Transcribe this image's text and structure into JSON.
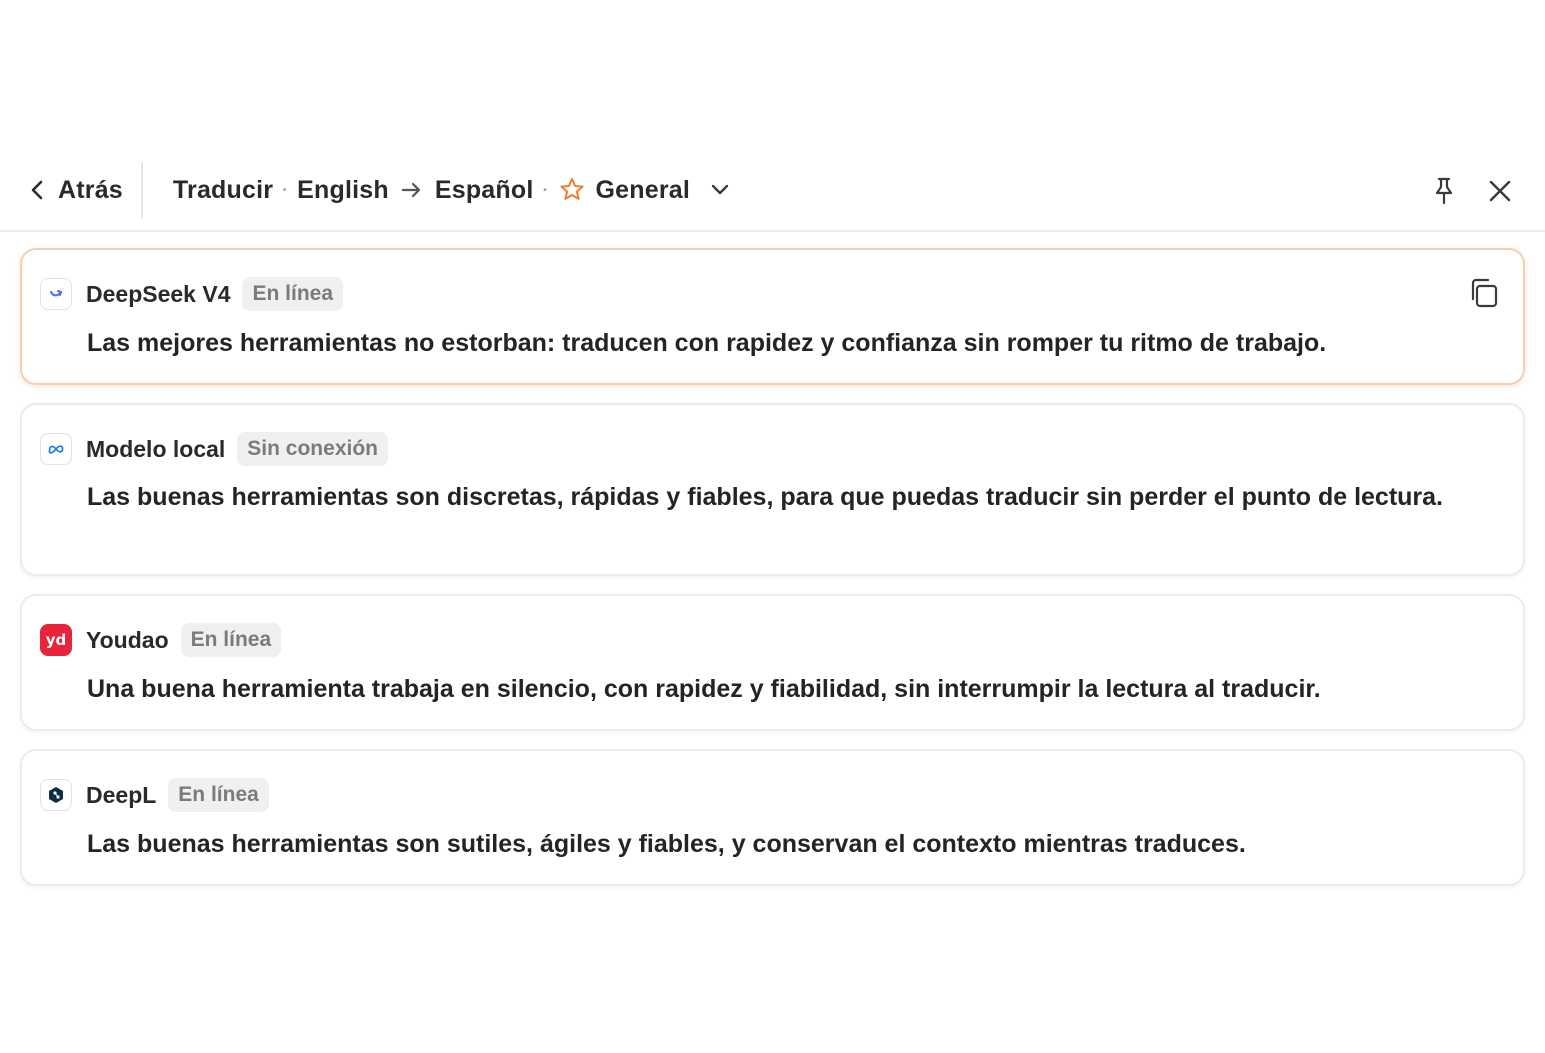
{
  "header": {
    "back_label": "Atrás",
    "mode": "Traducir",
    "source_lang": "English",
    "target_lang": "Español",
    "profile": "General",
    "accent_color": "#f07d2f"
  },
  "results": [
    {
      "provider": "DeepSeek V4",
      "status": "En línea",
      "text": "Las mejores herramientas no estorban: traducen con rapidez y confianza sin romper tu ritmo de trabajo.",
      "icon": "deepseek-logo-icon",
      "selected": true
    },
    {
      "provider": "Modelo local",
      "status": "Sin conexión",
      "text": "Las buenas herramientas son discretas, rápidas y fiables, para que puedas traducir sin perder el punto de lectura.",
      "icon": "meta-logo-icon"
    },
    {
      "provider": "Youdao",
      "status": "En línea",
      "text": "Una buena herramienta trabaja en silencio, con rapidez y fiabilidad, sin interrumpir la lectura al traducir.",
      "icon": "youdao-logo-icon",
      "logo_text": "yd"
    },
    {
      "provider": "DeepL",
      "status": "En línea",
      "text": "Las buenas herramientas son sutiles, ágiles y fiables, y conservan el contexto mientras traduces.",
      "icon": "deepl-logo-icon"
    }
  ]
}
